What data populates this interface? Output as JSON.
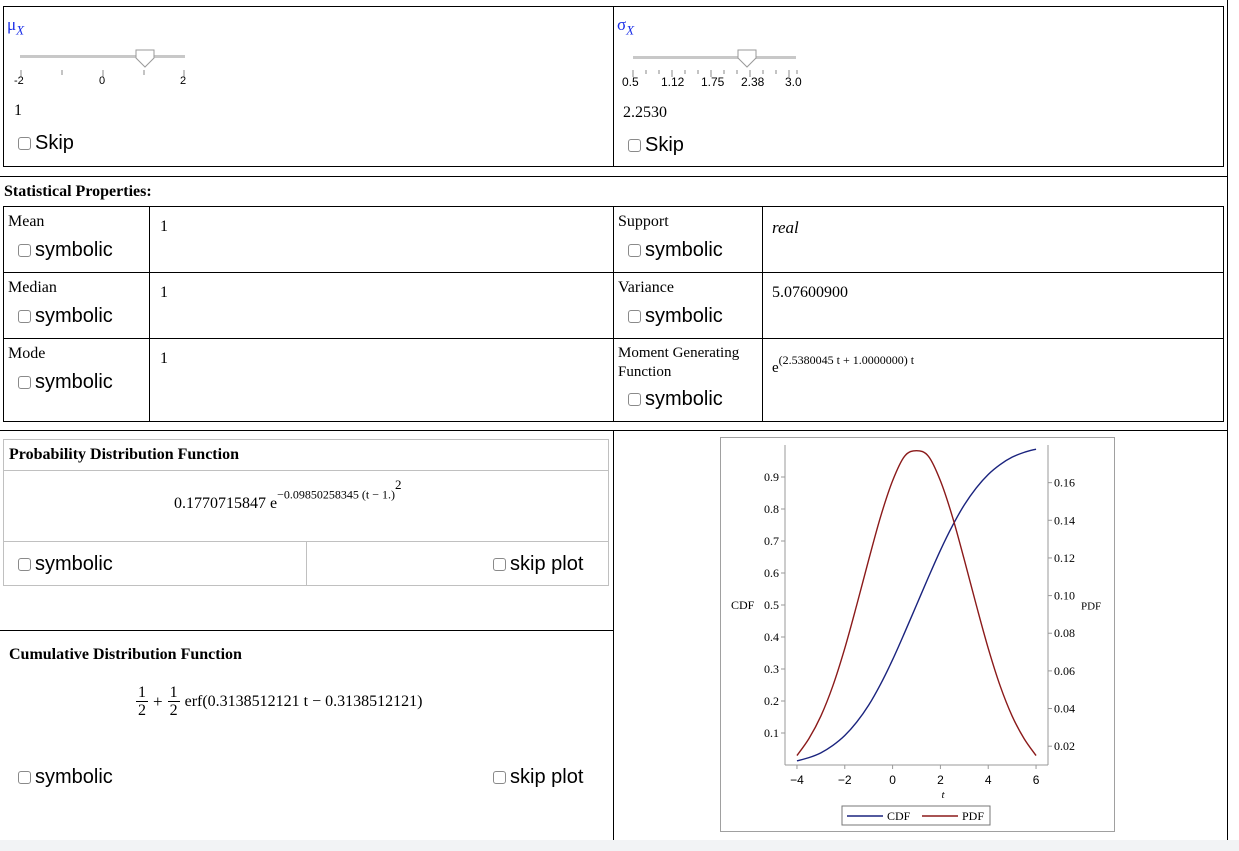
{
  "mu_slider": {
    "label": "μ",
    "label_sub": "X",
    "min": -2,
    "max": 3,
    "value": 1,
    "tick_labels": [
      "-2",
      "0",
      "2"
    ],
    "value_text": "1",
    "skip_label": "Skip"
  },
  "sigma_slider": {
    "label": "σ",
    "label_sub": "X",
    "min": 0.5,
    "max": 3.0,
    "value": 2.253,
    "tick_labels": [
      "0.5",
      "1.12",
      "1.75",
      "2.38",
      "3.0"
    ],
    "value_text": "2.2530",
    "skip_label": "Skip"
  },
  "stats": {
    "heading": "Statistical Properties:",
    "symbolic_label": "symbolic",
    "mean_label": "Mean",
    "mean_value": "1",
    "median_label": "Median",
    "median_value": "1",
    "mode_label": "Mode",
    "mode_value": "1",
    "support_label": "Support",
    "support_value": "real",
    "variance_label": "Variance",
    "variance_value": "5.07600900",
    "mgf_label_line1": "Moment Generating",
    "mgf_label_line2": "Function",
    "mgf_base": "e",
    "mgf_exponent": "(2.5380045 t + 1.0000000) t"
  },
  "pdf": {
    "heading": "Probability Distribution Function",
    "coef": "0.1770715847 e",
    "exponent": "−0.09850258345 (t − 1.)",
    "power": "2",
    "symbolic_label": "symbolic",
    "skip_plot_label": "skip plot"
  },
  "cdf": {
    "heading": "Cumulative Distribution Function",
    "half_num": "1",
    "half_den": "2",
    "plus": "+",
    "erf_text": "erf(0.3138512121 t − 0.3138512121)",
    "symbolic_label": "symbolic",
    "skip_plot_label": "skip plot"
  },
  "chart_data": {
    "type": "line",
    "x_range": [
      -4.5,
      6.5
    ],
    "x_ticks": [
      -4,
      -2,
      0,
      2,
      4,
      6
    ],
    "xlabel": "t",
    "ylabel_left": "CDF",
    "ylabel_right": "PDF",
    "ylim_left": [
      0,
      1
    ],
    "ylim_right": [
      0.01,
      0.18
    ],
    "y_ticks_left": [
      0.1,
      0.2,
      0.3,
      0.4,
      0.5,
      0.6,
      0.7,
      0.8,
      0.9
    ],
    "y_ticks_right": [
      0.02,
      0.04,
      0.06,
      0.08,
      0.1,
      0.12,
      0.14,
      0.16
    ],
    "grid": false,
    "legend_position": "bottom",
    "series": [
      {
        "name": "CDF",
        "axis": "left",
        "color": "#1a237e",
        "x": [
          -4,
          -3.5,
          -3,
          -2.5,
          -2,
          -1.5,
          -1,
          -0.5,
          0,
          0.5,
          1,
          1.5,
          2,
          2.5,
          3,
          3.5,
          4,
          4.5,
          5,
          5.5,
          6
        ],
        "y": [
          0.013,
          0.023,
          0.038,
          0.061,
          0.092,
          0.134,
          0.187,
          0.253,
          0.329,
          0.413,
          0.5,
          0.587,
          0.671,
          0.747,
          0.813,
          0.866,
          0.908,
          0.939,
          0.962,
          0.977,
          0.987
        ]
      },
      {
        "name": "PDF",
        "axis": "right",
        "color": "#8b1a1a",
        "x": [
          -4,
          -3.5,
          -3,
          -2.5,
          -2,
          -1.5,
          -1,
          -0.5,
          0,
          0.5,
          1,
          1.5,
          2,
          2.5,
          3,
          3.5,
          4,
          4.5,
          5,
          5.5,
          6
        ],
        "y": [
          0.015,
          0.024,
          0.036,
          0.052,
          0.072,
          0.095,
          0.119,
          0.142,
          0.161,
          0.174,
          0.177,
          0.174,
          0.161,
          0.142,
          0.119,
          0.095,
          0.072,
          0.052,
          0.036,
          0.024,
          0.015
        ]
      }
    ]
  },
  "colors": {
    "slider_label": "#1a2ee8",
    "cdf_line": "#1a237e",
    "pdf_line": "#8b1a1a"
  }
}
